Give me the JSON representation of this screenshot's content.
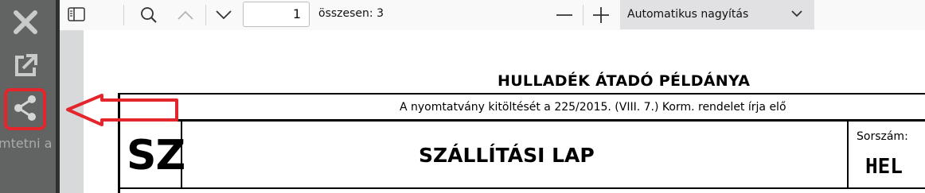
{
  "side_panel": {
    "close_icon": "close-icon",
    "external_icon": "open-external-icon",
    "share_icon": "share-icon",
    "truncated_label": "mtetni a"
  },
  "toolbar": {
    "page_number": "1",
    "page_count_label": "összesen: 3",
    "zoom_label": "Automatikus nagyítás"
  },
  "document": {
    "title": "HULLADÉK ÁTADÓ PÉLDÁNYA",
    "notice": "A nyomtatvány kitöltését a 225/2015. (VIII. 7.) Korm. rendelet írja elő",
    "code": "SZ",
    "form_title": "SZÁLLÍTÁSI LAP",
    "serial_label": "Sorszám:",
    "serial_value": "HEL"
  },
  "colors": {
    "highlight": "#e2262c",
    "side_panel": "#616463"
  }
}
